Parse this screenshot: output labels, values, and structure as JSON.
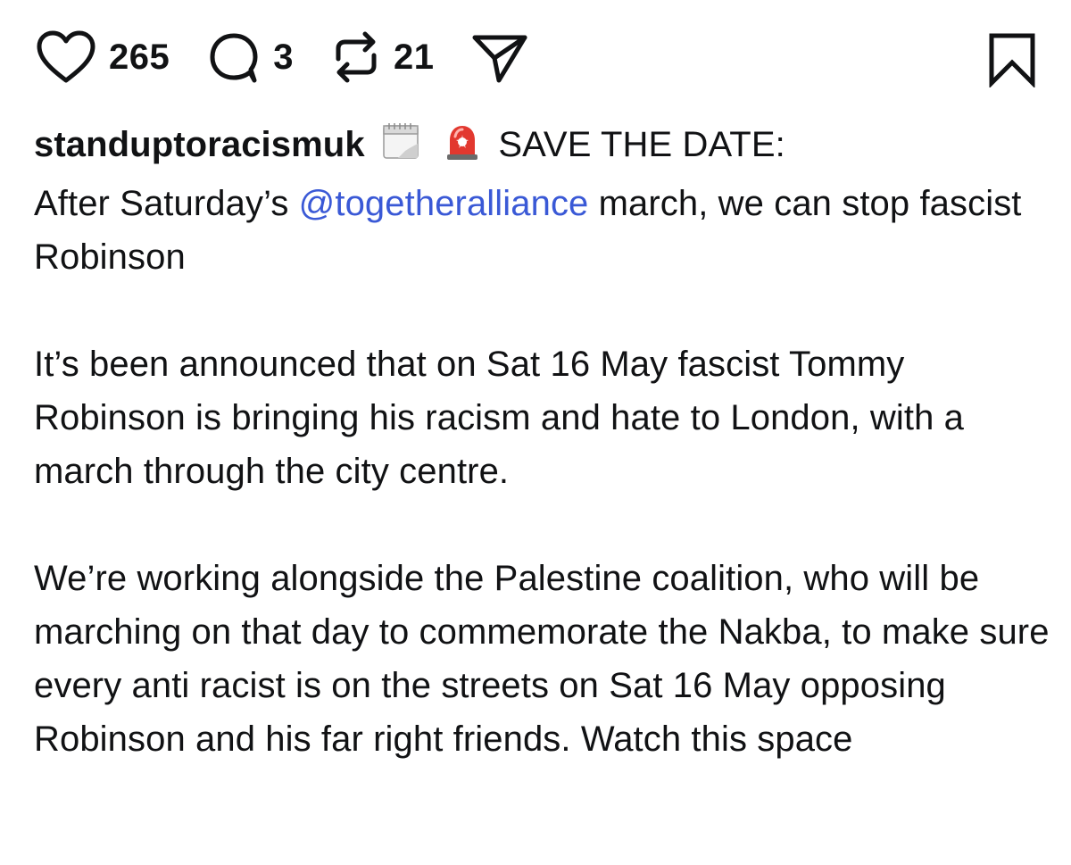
{
  "actions": {
    "likes": "265",
    "comments": "3",
    "reposts": "21"
  },
  "icons": {
    "like": "heart-icon",
    "comment": "comment-bubble-icon",
    "repost": "repost-arrows-icon",
    "share": "send-paper-plane-icon",
    "save": "bookmark-icon",
    "calendar": "calendar-emoji",
    "siren": "rotating-light-emoji"
  },
  "post": {
    "username": "standuptoracismuk",
    "headline": "SAVE THE DATE:",
    "line1_pre": "After Saturday’s ",
    "mention": "@togetheralliance",
    "line1_post": " march, we can stop fascist Robinson",
    "paragraph2": "It’s been announced that on Sat 16 May fascist Tommy Robinson is bringing his racism and hate to London, with a march through the city centre.",
    "paragraph3": "We’re working alongside the Palestine coalition, who will be marching on that day to commemorate the Nakba, to make sure every anti racist is on the streets on Sat 16 May opposing Robinson and his far right friends. Watch this space"
  },
  "colors": {
    "text": "#111214",
    "mention": "#3a59d6",
    "siren_red": "#e2382f"
  }
}
